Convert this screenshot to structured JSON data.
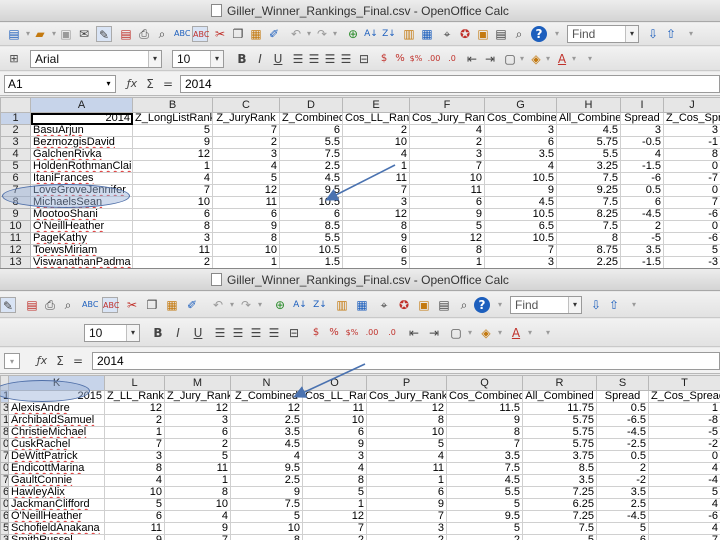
{
  "top": {
    "title": "Giller_Winner_Rankings_Final.csv - OpenOffice Calc",
    "font_name": "Arial",
    "font_size": "10",
    "find_placeholder": "Find",
    "cell_ref": "A1",
    "formula_value": "2014",
    "columns": [
      "A",
      "B",
      "C",
      "D",
      "E",
      "F",
      "G",
      "H",
      "I",
      "J"
    ],
    "rows": [
      {
        "n": "1",
        "cells": [
          "2014",
          "Z_LongListRank",
          "Z_JuryRank",
          "Z_Combined",
          "Cos_LL_Rank",
          "Cos_Jury_Rank",
          "Cos_Combined",
          "All_Combined",
          "Spread",
          "Z_Cos_Spread"
        ]
      },
      {
        "n": "2",
        "cells": [
          "BasuArjun",
          "5",
          "7",
          "6",
          "2",
          "4",
          "3",
          "4.5",
          "3",
          "3"
        ]
      },
      {
        "n": "3",
        "cells": [
          "BezmozgisDavid",
          "9",
          "2",
          "5.5",
          "10",
          "2",
          "6",
          "5.75",
          "-0.5",
          "-1"
        ]
      },
      {
        "n": "4",
        "cells": [
          "GalchenRivka",
          "12",
          "3",
          "7.5",
          "4",
          "3",
          "3.5",
          "5.5",
          "4",
          "8"
        ]
      },
      {
        "n": "5",
        "cells": [
          "HoldenRothmanClaire",
          "1",
          "4",
          "2.5",
          "1",
          "7",
          "4",
          "3.25",
          "-1.5",
          "0"
        ]
      },
      {
        "n": "6",
        "cells": [
          "ItaniFrances",
          "4",
          "5",
          "4.5",
          "11",
          "10",
          "10.5",
          "7.5",
          "-6",
          "-7"
        ]
      },
      {
        "n": "7",
        "cells": [
          "LoveGroveJennifer",
          "7",
          "12",
          "9.5",
          "7",
          "11",
          "9",
          "9.25",
          "0.5",
          "0"
        ]
      },
      {
        "n": "8",
        "cells": [
          "MichaelsSean",
          "10",
          "11",
          "10.5",
          "3",
          "6",
          "4.5",
          "7.5",
          "6",
          "7"
        ]
      },
      {
        "n": "9",
        "cells": [
          "MootooShani",
          "6",
          "6",
          "6",
          "12",
          "9",
          "10.5",
          "8.25",
          "-4.5",
          "-6"
        ]
      },
      {
        "n": "10",
        "cells": [
          "O'NeillHeather",
          "8",
          "9",
          "8.5",
          "8",
          "5",
          "6.5",
          "7.5",
          "2",
          "0"
        ]
      },
      {
        "n": "11",
        "cells": [
          "PageKathy",
          "3",
          "8",
          "5.5",
          "9",
          "12",
          "10.5",
          "8",
          "-5",
          "-6"
        ]
      },
      {
        "n": "12",
        "cells": [
          "ToewsMiriam",
          "11",
          "10",
          "10.5",
          "6",
          "8",
          "7",
          "8.75",
          "3.5",
          "5"
        ]
      },
      {
        "n": "13",
        "cells": [
          "ViswanathanPadma",
          "2",
          "1",
          "1.5",
          "5",
          "1",
          "3",
          "2.25",
          "-1.5",
          "-3"
        ]
      }
    ]
  },
  "bottom": {
    "title": "Giller_Winner_Rankings_Final.csv - OpenOffice Calc",
    "font_size": "10",
    "find_placeholder": "Find",
    "formula_value": "2014",
    "columns": [
      "K",
      "L",
      "M",
      "N",
      "O",
      "P",
      "Q",
      "R",
      "S",
      "T"
    ],
    "rows": [
      {
        "n": "1",
        "cells": [
          "2015",
          "Z_LL_Rank",
          "Z_Jury_Rank",
          "Z_Combined",
          "Cos_LL_Rank",
          "Cos_Jury_Rank",
          "Cos_Combined",
          "All_Combined",
          "Spread",
          "Z_Cos_Spread"
        ]
      },
      {
        "n": "3",
        "cells": [
          "AlexisAndre",
          "12",
          "12",
          "12",
          "11",
          "12",
          "11.5",
          "11.75",
          "0.5",
          "1"
        ]
      },
      {
        "n": "1",
        "cells": [
          "ArchibaldSamuel",
          "2",
          "3",
          "2.5",
          "10",
          "8",
          "9",
          "5.75",
          "-6.5",
          "-8"
        ]
      },
      {
        "n": "8",
        "cells": [
          "ChristieMichael",
          "1",
          "6",
          "3.5",
          "6",
          "10",
          "8",
          "5.75",
          "-4.5",
          "-5"
        ]
      },
      {
        "n": "0",
        "cells": [
          "CuskRachel",
          "7",
          "2",
          "4.5",
          "9",
          "5",
          "7",
          "5.75",
          "-2.5",
          "-2"
        ]
      },
      {
        "n": "7",
        "cells": [
          "DeWittPatrick",
          "3",
          "5",
          "4",
          "3",
          "4",
          "3.5",
          "3.75",
          "0.5",
          "0"
        ]
      },
      {
        "n": "0",
        "cells": [
          "EndicottMarina",
          "8",
          "11",
          "9.5",
          "4",
          "11",
          "7.5",
          "8.5",
          "2",
          "4"
        ]
      },
      {
        "n": "7",
        "cells": [
          "GaultConnie",
          "4",
          "1",
          "2.5",
          "8",
          "1",
          "4.5",
          "3.5",
          "-2",
          "-4"
        ]
      },
      {
        "n": "6",
        "cells": [
          "HawleyAlix",
          "10",
          "8",
          "9",
          "5",
          "6",
          "5.5",
          "7.25",
          "3.5",
          "5"
        ]
      },
      {
        "n": "0",
        "cells": [
          "JackmanClifford",
          "5",
          "10",
          "7.5",
          "1",
          "9",
          "5",
          "6.25",
          "2.5",
          "4"
        ]
      },
      {
        "n": "6",
        "cells": [
          "O'NeillHeather",
          "6",
          "4",
          "5",
          "12",
          "7",
          "9.5",
          "7.25",
          "-4.5",
          "-6"
        ]
      },
      {
        "n": "5",
        "cells": [
          "SchofieldAnakana",
          "11",
          "9",
          "10",
          "7",
          "3",
          "5",
          "7.5",
          "5",
          "4"
        ]
      },
      {
        "n": "3",
        "cells": [
          "SmithRussel",
          "9",
          "7",
          "8",
          "2",
          "2",
          "2",
          "5",
          "6",
          "7"
        ]
      }
    ]
  },
  "icons": {
    "new": "new-document-icon",
    "open": "open-folder-icon",
    "save": "save-icon",
    "email": "email-icon",
    "edit": "edit-file-icon",
    "pdf": "export-pdf-icon",
    "print": "print-icon",
    "preview": "print-preview-icon",
    "spell": "spellcheck-icon",
    "autospell": "autospellcheck-icon",
    "cut": "cut-icon",
    "copy": "copy-icon",
    "paste": "paste-icon",
    "brush": "clone-formatting-icon",
    "undo": "undo-icon",
    "redo": "redo-icon",
    "hyperlink": "hyperlink-icon",
    "sortasc": "sort-ascending-icon",
    "sortdesc": "sort-descending-icon",
    "chart": "chart-icon",
    "pivot": "pivot-table-icon",
    "find": "find-replace-icon",
    "navigator": "navigator-icon",
    "gallery": "gallery-icon",
    "datasource": "data-sources-icon",
    "zoom": "zoom-icon",
    "help": "help-icon"
  }
}
